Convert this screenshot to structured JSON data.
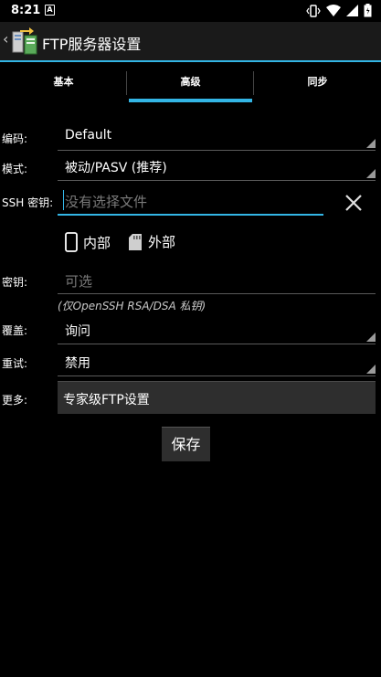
{
  "status_bar": {
    "time": "8:21",
    "notification_letter": "A"
  },
  "action_bar": {
    "title": "FTP服务器设置"
  },
  "tabs": [
    {
      "label": "基本"
    },
    {
      "label": "高级"
    },
    {
      "label": "同步"
    }
  ],
  "form": {
    "encoding": {
      "label": "编码:",
      "value": "Default"
    },
    "mode": {
      "label": "模式:",
      "value": "被动/PASV (推荐)"
    },
    "ssh_key": {
      "label": "SSH 密钥:",
      "placeholder": "没有选择文件"
    },
    "storage": {
      "internal": "内部",
      "external": "外部"
    },
    "passphrase": {
      "label": "密钥:",
      "placeholder": "可选",
      "hint": "(仅OpenSSH RSA/DSA 私钥)"
    },
    "overwrite": {
      "label": "覆盖:",
      "value": "询问"
    },
    "retry": {
      "label": "重试:",
      "value": "禁用"
    },
    "more": {
      "label": "更多:",
      "button": "专家级FTP设置"
    },
    "save_label": "保存"
  },
  "colors": {
    "accent": "#33b5e5",
    "background": "#000000",
    "button_bg": "#2e2e2e"
  }
}
